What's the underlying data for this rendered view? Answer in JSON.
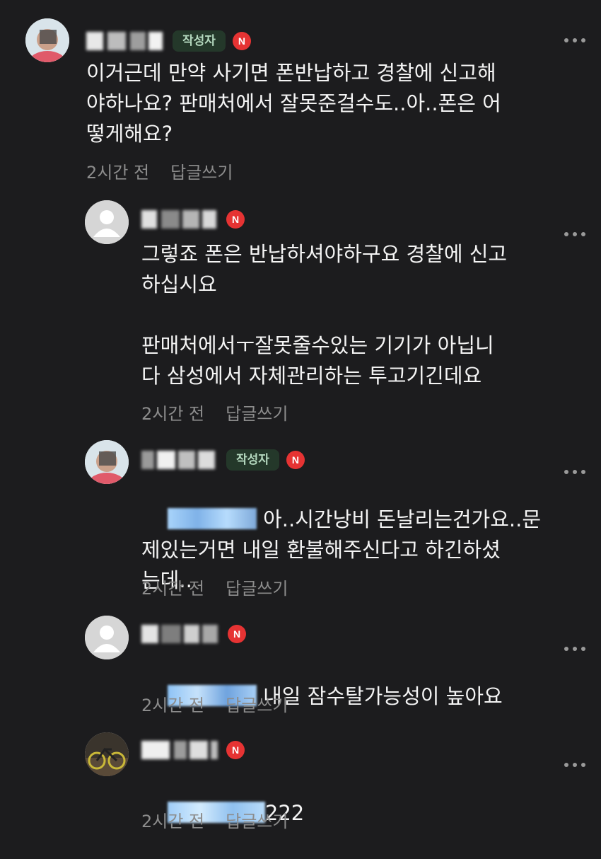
{
  "comments": [
    {
      "text": "이거근데 만약 사기면 폰반납하고 경찰에 신고해\n야하나요? 판매처에서 잘못준걸수도..아..폰은 어\n떻게해요?",
      "author_badge": "작성자",
      "n_badge": "N",
      "time": "2시간 전",
      "reply": "답글쓰기"
    },
    {
      "text": "그렇죠 폰은 반납하셔야하구요 경찰에 신고\n하십시요\n\n판매처에서ㅜ잘못줄수있는 기기가 아닙니\n다 삼성에서 자체관리하는 투고기긴데요",
      "n_badge": "N",
      "time": "2시간 전",
      "reply": "답글쓰기"
    },
    {
      "text": " 아..시간낭비 돈날리는건가요..문\n제있는거면 내일 환불해주신다고 하긴하셨\n는데..",
      "author_badge": "작성자",
      "n_badge": "N",
      "time": "2시간 전",
      "reply": "답글쓰기"
    },
    {
      "text": " 내일 잠수탈가능성이 높아요",
      "n_badge": "N",
      "time": "2시간 전",
      "reply": "답글쓰기"
    },
    {
      "text": "222",
      "n_badge": "N",
      "time": "2시간 전",
      "reply": "답글쓰기"
    }
  ],
  "colors": {
    "background": "#1c1c1e",
    "author_badge_bg": "#24382a",
    "author_badge_text": "#b5d9bf",
    "n_badge": "#e63333",
    "meta_text": "#8c8c8c",
    "mention_blur": "#8ec3f5"
  },
  "icons": [
    "profile-photo",
    "default-avatar-icon",
    "bicycle-photo",
    "more-options-icon"
  ]
}
